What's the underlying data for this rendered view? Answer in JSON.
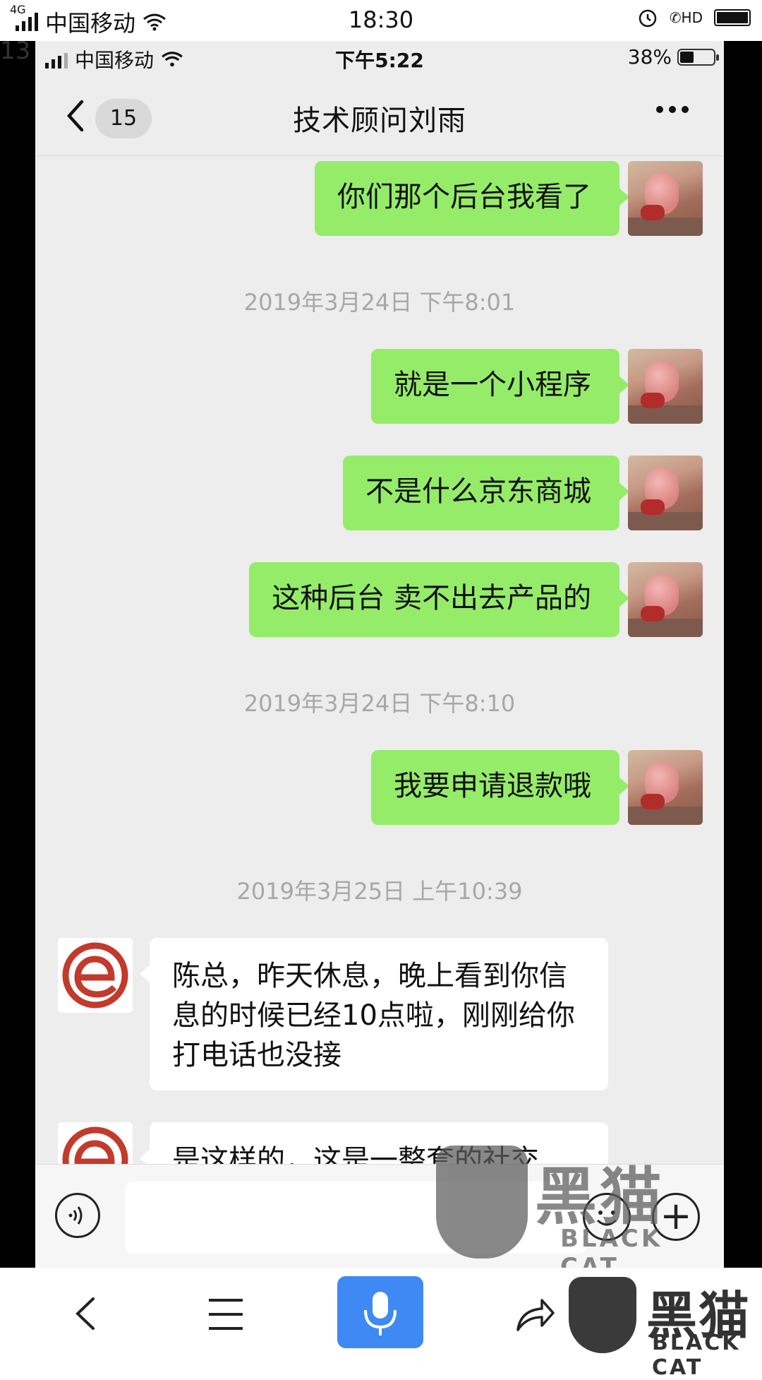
{
  "outer_status": {
    "network_tag": "4G",
    "carrier": "中国移动",
    "time": "18:30",
    "hd_label": "HD"
  },
  "side_number": "13",
  "inner_status": {
    "carrier": "中国移动",
    "time": "下午5:22",
    "battery_text": "38%",
    "battery_level": 0.38
  },
  "chat": {
    "back_label": "<",
    "unread_badge": "15",
    "title": "技术顾问刘雨",
    "more_icon": "more-dots-icon",
    "timestamps": [
      "2019年3月24日 下午8:01",
      "2019年3月24日 下午8:10",
      "2019年3月25日 上午10:39"
    ],
    "messages": [
      {
        "from": "me",
        "text": "你们那个后台我看了"
      },
      {
        "from": "me",
        "text": "就是一个小程序"
      },
      {
        "from": "me",
        "text": "不是什么京东商城"
      },
      {
        "from": "me",
        "text": "这种后台 卖不出去产品的"
      },
      {
        "from": "me",
        "text": "我要申请退款哦"
      },
      {
        "from": "them",
        "text": "陈总，昨天休息，晚上看到你信息的时候已经10点啦，刚刚给你打电话也没接"
      },
      {
        "from": "them",
        "text": "是这样的，这是一整套的社交"
      }
    ]
  },
  "input_bar": {
    "voice_icon": "voice-icon",
    "emoji_icon": "emoji-icon",
    "plus_icon": "plus-icon",
    "plus_label": "+"
  },
  "watermark": {
    "cn": "黑猫",
    "en": "BLACK CAT"
  },
  "browser_bar": {
    "back_icon": "back-arrow-icon",
    "menu_icon": "menu-icon",
    "mic_icon": "microphone-icon",
    "share_icon": "share-icon"
  },
  "colors": {
    "my_bubble": "#95ec69",
    "their_bubble": "#ffffff",
    "chat_bg": "#ededed",
    "mic_button": "#3f89f4",
    "logo_red": "#c23a2b"
  }
}
